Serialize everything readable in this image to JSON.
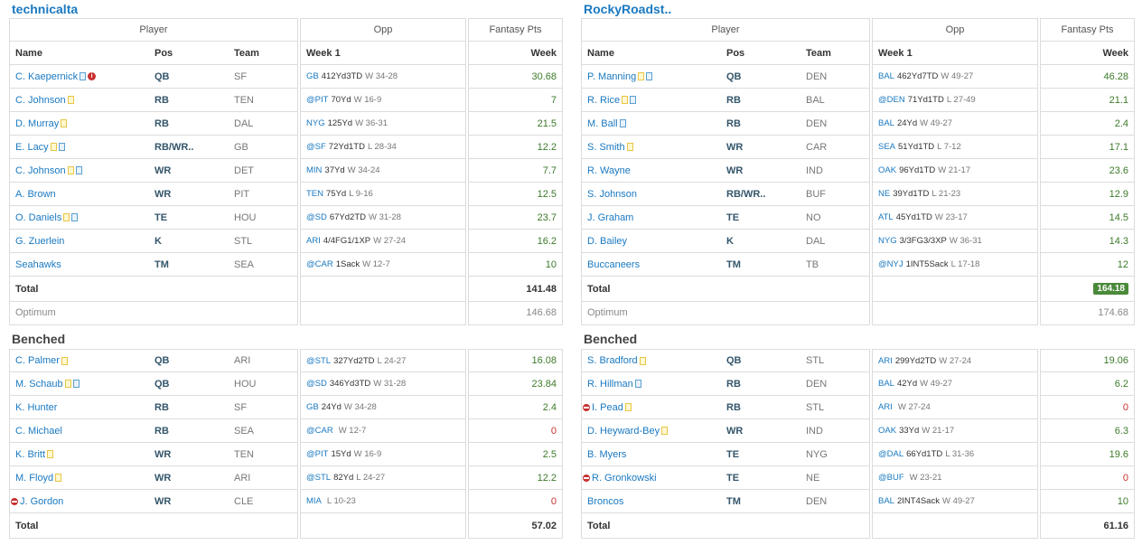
{
  "teams": [
    {
      "name": "technicalta",
      "headers": {
        "player": "Player",
        "opp": "Opp",
        "pts": "Fantasy Pts",
        "name": "Name",
        "pos": "Pos",
        "team": "Team",
        "week": "Week 1",
        "week_pts": "Week"
      },
      "starters": [
        {
          "name": "C. Kaepernick",
          "icons": [
            "note-blue",
            "info"
          ],
          "pos": "QB",
          "team": "SF",
          "opp": "GB",
          "stat": "412Yd3TD",
          "result": "W 34-28",
          "pts": "30.68"
        },
        {
          "name": "C. Johnson",
          "icons": [
            "note"
          ],
          "pos": "RB",
          "team": "TEN",
          "opp": "@PIT",
          "stat": "70Yd",
          "result": "W 16-9",
          "pts": "7"
        },
        {
          "name": "D. Murray",
          "icons": [
            "note"
          ],
          "pos": "RB",
          "team": "DAL",
          "opp": "NYG",
          "stat": "125Yd",
          "result": "W 36-31",
          "pts": "21.5"
        },
        {
          "name": "E. Lacy",
          "icons": [
            "note",
            "note-blue"
          ],
          "pos": "RB/WR..",
          "team": "GB",
          "opp": "@SF",
          "stat": "72Yd1TD",
          "result": "L 28-34",
          "pts": "12.2"
        },
        {
          "name": "C. Johnson",
          "icons": [
            "note",
            "note-blue"
          ],
          "pos": "WR",
          "team": "DET",
          "opp": "MIN",
          "stat": "37Yd",
          "result": "W 34-24",
          "pts": "7.7"
        },
        {
          "name": "A. Brown",
          "icons": [],
          "pos": "WR",
          "team": "PIT",
          "opp": "TEN",
          "stat": "75Yd",
          "result": "L 9-16",
          "pts": "12.5"
        },
        {
          "name": "O. Daniels",
          "icons": [
            "note",
            "note-blue"
          ],
          "pos": "TE",
          "team": "HOU",
          "opp": "@SD",
          "stat": "67Yd2TD",
          "result": "W 31-28",
          "pts": "23.7"
        },
        {
          "name": "G. Zuerlein",
          "icons": [],
          "pos": "K",
          "team": "STL",
          "opp": "ARI",
          "stat": "4/4FG1/1XP",
          "result": "W 27-24",
          "pts": "16.2"
        },
        {
          "name": "Seahawks",
          "icons": [],
          "pos": "TM",
          "team": "SEA",
          "opp": "@CAR",
          "stat": "1Sack",
          "result": "W 12-7",
          "pts": "10"
        }
      ],
      "total_label": "Total",
      "total": "141.48",
      "total_badge": false,
      "optimum_label": "Optimum",
      "optimum": "146.68",
      "bench_title": "Benched",
      "bench": [
        {
          "name": "C. Palmer",
          "icons": [
            "note"
          ],
          "pos": "QB",
          "team": "ARI",
          "opp": "@STL",
          "stat": "327Yd2TD",
          "result": "L 24-27",
          "pts": "16.08",
          "minus": false
        },
        {
          "name": "M. Schaub",
          "icons": [
            "note",
            "note-blue"
          ],
          "pos": "QB",
          "team": "HOU",
          "opp": "@SD",
          "stat": "346Yd3TD",
          "result": "W 31-28",
          "pts": "23.84",
          "minus": false
        },
        {
          "name": "K. Hunter",
          "icons": [],
          "pos": "RB",
          "team": "SF",
          "opp": "GB",
          "stat": "24Yd",
          "result": "W 34-28",
          "pts": "2.4",
          "minus": false
        },
        {
          "name": "C. Michael",
          "icons": [],
          "pos": "RB",
          "team": "SEA",
          "opp": "@CAR",
          "stat": "",
          "result": "W 12-7",
          "pts": "0",
          "minus": false
        },
        {
          "name": "K. Britt",
          "icons": [
            "note"
          ],
          "pos": "WR",
          "team": "TEN",
          "opp": "@PIT",
          "stat": "15Yd",
          "result": "W 16-9",
          "pts": "2.5",
          "minus": false
        },
        {
          "name": "M. Floyd",
          "icons": [
            "note"
          ],
          "pos": "WR",
          "team": "ARI",
          "opp": "@STL",
          "stat": "82Yd",
          "result": "L 24-27",
          "pts": "12.2",
          "minus": false
        },
        {
          "name": "J. Gordon",
          "icons": [],
          "pos": "WR",
          "team": "CLE",
          "opp": "MIA",
          "stat": "",
          "result": "L 10-23",
          "pts": "0",
          "minus": true
        }
      ],
      "bench_total": "57.02"
    },
    {
      "name": "RockyRoadst..",
      "headers": {
        "player": "Player",
        "opp": "Opp",
        "pts": "Fantasy Pts",
        "name": "Name",
        "pos": "Pos",
        "team": "Team",
        "week": "Week 1",
        "week_pts": "Week"
      },
      "starters": [
        {
          "name": "P. Manning",
          "icons": [
            "note",
            "note-blue"
          ],
          "pos": "QB",
          "team": "DEN",
          "opp": "BAL",
          "stat": "462Yd7TD",
          "result": "W 49-27",
          "pts": "46.28"
        },
        {
          "name": "R. Rice",
          "icons": [
            "note",
            "note-blue"
          ],
          "pos": "RB",
          "team": "BAL",
          "opp": "@DEN",
          "stat": "71Yd1TD",
          "result": "L 27-49",
          "pts": "21.1"
        },
        {
          "name": "M. Ball",
          "icons": [
            "note-blue"
          ],
          "pos": "RB",
          "team": "DEN",
          "opp": "BAL",
          "stat": "24Yd",
          "result": "W 49-27",
          "pts": "2.4"
        },
        {
          "name": "S. Smith",
          "icons": [
            "note"
          ],
          "pos": "WR",
          "team": "CAR",
          "opp": "SEA",
          "stat": "51Yd1TD",
          "result": "L 7-12",
          "pts": "17.1"
        },
        {
          "name": "R. Wayne",
          "icons": [],
          "pos": "WR",
          "team": "IND",
          "opp": "OAK",
          "stat": "96Yd1TD",
          "result": "W 21-17",
          "pts": "23.6"
        },
        {
          "name": "S. Johnson",
          "icons": [],
          "pos": "RB/WR..",
          "team": "BUF",
          "opp": "NE",
          "stat": "39Yd1TD",
          "result": "L 21-23",
          "pts": "12.9"
        },
        {
          "name": "J. Graham",
          "icons": [],
          "pos": "TE",
          "team": "NO",
          "opp": "ATL",
          "stat": "45Yd1TD",
          "result": "W 23-17",
          "pts": "14.5"
        },
        {
          "name": "D. Bailey",
          "icons": [],
          "pos": "K",
          "team": "DAL",
          "opp": "NYG",
          "stat": "3/3FG3/3XP",
          "result": "W 36-31",
          "pts": "14.3"
        },
        {
          "name": "Buccaneers",
          "icons": [],
          "pos": "TM",
          "team": "TB",
          "opp": "@NYJ",
          "stat": "1INT5Sack",
          "result": "L 17-18",
          "pts": "12"
        }
      ],
      "total_label": "Total",
      "total": "164.18",
      "total_badge": true,
      "optimum_label": "Optimum",
      "optimum": "174.68",
      "bench_title": "Benched",
      "bench": [
        {
          "name": "S. Bradford",
          "icons": [
            "note"
          ],
          "pos": "QB",
          "team": "STL",
          "opp": "ARI",
          "stat": "299Yd2TD",
          "result": "W 27-24",
          "pts": "19.06",
          "minus": false
        },
        {
          "name": "R. Hillman",
          "icons": [
            "note-blue"
          ],
          "pos": "RB",
          "team": "DEN",
          "opp": "BAL",
          "stat": "42Yd",
          "result": "W 49-27",
          "pts": "6.2",
          "minus": false
        },
        {
          "name": "I. Pead",
          "icons": [
            "note"
          ],
          "pos": "RB",
          "team": "STL",
          "opp": "ARI",
          "stat": "",
          "result": "W 27-24",
          "pts": "0",
          "minus": true
        },
        {
          "name": "D. Heyward-Bey",
          "icons": [
            "note"
          ],
          "pos": "WR",
          "team": "IND",
          "opp": "OAK",
          "stat": "33Yd",
          "result": "W 21-17",
          "pts": "6.3",
          "minus": false
        },
        {
          "name": "B. Myers",
          "icons": [],
          "pos": "TE",
          "team": "NYG",
          "opp": "@DAL",
          "stat": "66Yd1TD",
          "result": "L 31-36",
          "pts": "19.6",
          "minus": false
        },
        {
          "name": "R. Gronkowski",
          "icons": [],
          "pos": "TE",
          "team": "NE",
          "opp": "@BUF",
          "stat": "",
          "result": "W 23-21",
          "pts": "0",
          "minus": true
        },
        {
          "name": "Broncos",
          "icons": [],
          "pos": "TM",
          "team": "DEN",
          "opp": "BAL",
          "stat": "2INT4Sack",
          "result": "W 49-27",
          "pts": "10",
          "minus": false
        }
      ],
      "bench_total": "61.16"
    }
  ]
}
